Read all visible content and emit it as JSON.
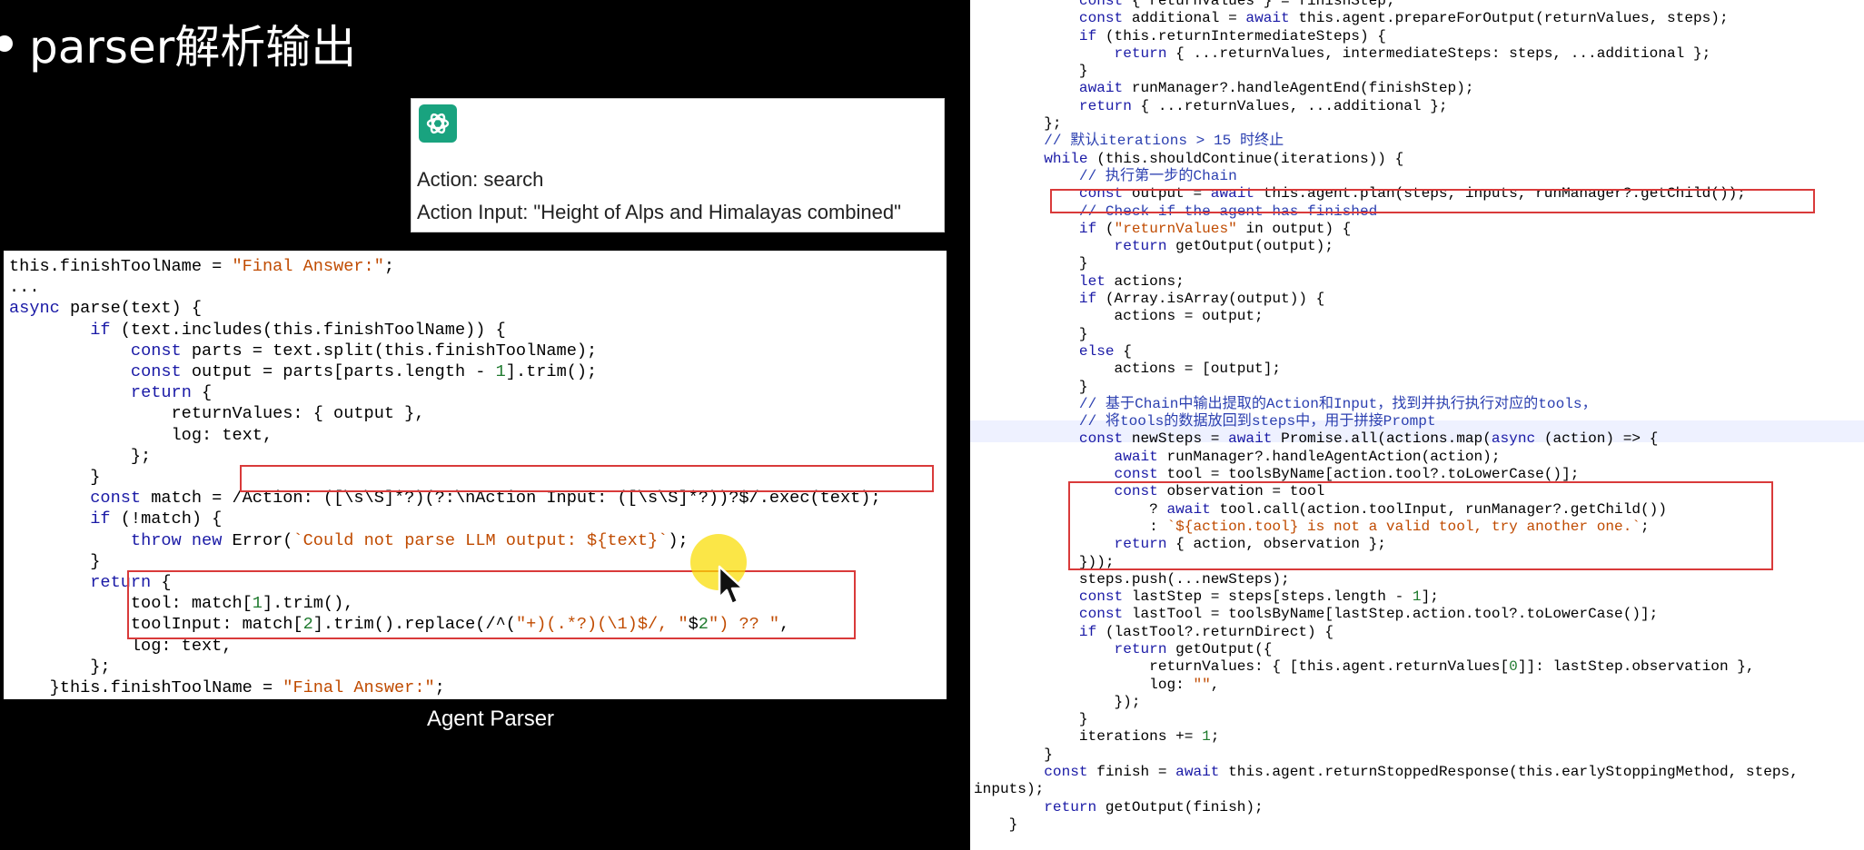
{
  "slide": {
    "title": "parser解析输出",
    "caption": "Agent Parser"
  },
  "chatgpt_card": {
    "logo_icon": "openai-logo-icon",
    "action_line": "Action: search",
    "action_input_line": "Action Input: \"Height of Alps and Himalayas combined\""
  },
  "left_code": {
    "lines": [
      "this.finishToolName = \"Final Answer:\";",
      "...",
      "async parse(text) {",
      "        if (text.includes(this.finishToolName)) {",
      "            const parts = text.split(this.finishToolName);",
      "            const output = parts[parts.length - 1].trim();",
      "            return {",
      "                returnValues: { output },",
      "                log: text,",
      "            };",
      "        }",
      "        const match = /Action: ([\\s\\S]*?)(?:\\nAction Input: ([\\s\\S]*?))?$/.exec(text);",
      "        if (!match) {",
      "            throw new Error(`Could not parse LLM output: ${text}`);",
      "        }",
      "        return {",
      "            tool: match[1].trim(),",
      "            toolInput: match[2].trim().replace(/^(\"+)(.*?)(\\1)$/, \"$2\") ?? \"\",",
      "            log: text,",
      "        };",
      "    }this.finishToolName = \"Final Answer:\";",
      "..."
    ]
  },
  "right_code": {
    "lines": [
      "            const { returnValues } = finishStep;",
      "            const additional = await this.agent.prepareForOutput(returnValues, steps);",
      "            if (this.returnIntermediateSteps) {",
      "                return { ...returnValues, intermediateSteps: steps, ...additional };",
      "            }",
      "            await runManager?.handleAgentEnd(finishStep);",
      "            return { ...returnValues, ...additional };",
      "        };",
      "        // 默认iterations > 15 时终止",
      "        while (this.shouldContinue(iterations)) {",
      "            // 执行第一步的Chain",
      "            const output = await this.agent.plan(steps, inputs, runManager?.getChild());",
      "            // Check if the agent has finished",
      "            if (\"returnValues\" in output) {",
      "                return getOutput(output);",
      "            }",
      "            let actions;",
      "            if (Array.isArray(output)) {",
      "                actions = output;",
      "            }",
      "            else {",
      "                actions = [output];",
      "            }",
      "            // 基于Chain中输出提取的Action和Input，找到并执行执行对应的tools，",
      "            // 将tools的数据放回到steps中，用于拼接Prompt",
      "            const newSteps = await Promise.all(actions.map(async (action) => {",
      "                await runManager?.handleAgentAction(action);",
      "                const tool = toolsByName[action.tool?.toLowerCase()];",
      "                const observation = tool",
      "                    ? await tool.call(action.toolInput, runManager?.getChild())",
      "                    : `${action.tool} is not a valid tool, try another one.`;",
      "                return { action, observation };",
      "            }));",
      "            steps.push(...newSteps);",
      "            const lastStep = steps[steps.length - 1];",
      "            const lastTool = toolsByName[lastStep.action.tool?.toLowerCase()];",
      "            if (lastTool?.returnDirect) {",
      "                return getOutput({",
      "                    returnValues: { [this.agent.returnValues[0]]: lastStep.observation },",
      "                    log: \"\",",
      "                });",
      "            }",
      "            iterations += 1;",
      "        }",
      "        const finish = await this.agent.returnStoppedResponse(this.earlyStoppingMethod, steps,",
      "inputs);",
      "        return getOutput(finish);",
      "    }"
    ]
  },
  "colors": {
    "keyword": "#1a1aa6",
    "string": "#c04b00",
    "comment": "#2b3fb0",
    "highlight_box": "#d93a3a",
    "cursor_highlight": "#fadc00"
  },
  "cursor_icon": "mouse-pointer-icon"
}
